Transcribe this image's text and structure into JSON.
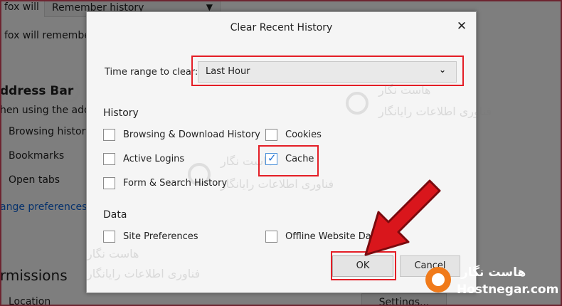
{
  "background": {
    "history_label": "fox will",
    "history_select": "Remember history",
    "remember_text": "fox will remember",
    "address_bar_heading": "ddress Bar",
    "address_bar_sub": "hen using the addr",
    "items": [
      "Browsing history",
      "Bookmarks",
      "Open tabs"
    ],
    "change_link": "ange preferences",
    "permissions_heading": "rmissions",
    "location": "Location",
    "settings_button": "Settings..."
  },
  "dialog": {
    "title": "Clear Recent History",
    "time_range_label": "Time range to clear:",
    "time_range_value": "Last Hour",
    "history_section": "History",
    "history_items": [
      {
        "label": "Browsing & Download History",
        "checked": false
      },
      {
        "label": "Cookies",
        "checked": false
      },
      {
        "label": "Active Logins",
        "checked": false
      },
      {
        "label": "Cache",
        "checked": true
      },
      {
        "label": "Form & Search History",
        "checked": false
      }
    ],
    "data_section": "Data",
    "data_items": [
      {
        "label": "Site Preferences",
        "checked": false
      },
      {
        "label": "Offline Website Data",
        "checked": false
      }
    ],
    "ok_label": "OK",
    "cancel_label": "Cancel"
  },
  "watermark": {
    "fa_title": "هاست نگار",
    "fa_sub": "فناوری اطلاعات رایانگار"
  },
  "brand": {
    "fa_name": "هاست نگار",
    "domain": "Hostnegar.com"
  },
  "colors": {
    "highlight": "#e41e26",
    "arrow": "#d9161c",
    "check": "#1b6fd6",
    "brand_orange": "#f07a1a"
  }
}
